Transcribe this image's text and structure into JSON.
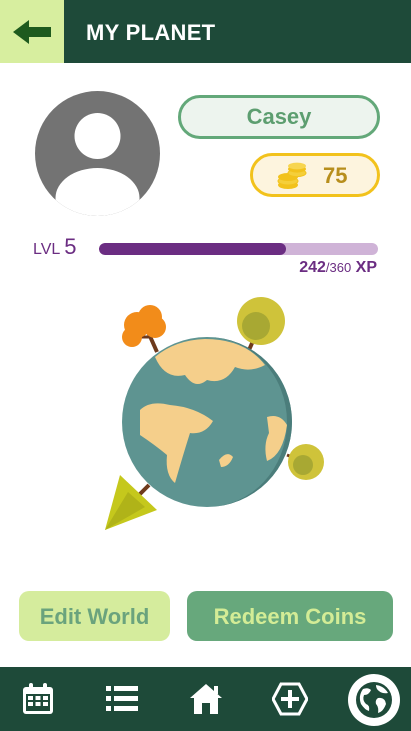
{
  "header": {
    "title": "MY PLANET",
    "back_icon": "arrow-left-icon"
  },
  "profile": {
    "avatar_icon": "user-avatar-icon",
    "name": "Casey",
    "coins_icon": "coin-stack-icon",
    "coins": "75"
  },
  "level": {
    "label": "LVL",
    "number": "5",
    "xp_current": "242",
    "xp_max": "/360",
    "xp_unit": "XP",
    "progress": 0.672
  },
  "actions": {
    "edit_label": "Edit World",
    "redeem_label": "Redeem Coins"
  },
  "nav": {
    "items": [
      "calendar-icon",
      "list-icon",
      "home-icon",
      "add-icon",
      "globe-icon"
    ]
  },
  "colors": {
    "header_bg": "#1e4a39",
    "accent_green": "#67a87c",
    "light_green": "#d5ec9d",
    "coin_gold": "#f2c21c",
    "xp_purple": "#6b2d82"
  }
}
